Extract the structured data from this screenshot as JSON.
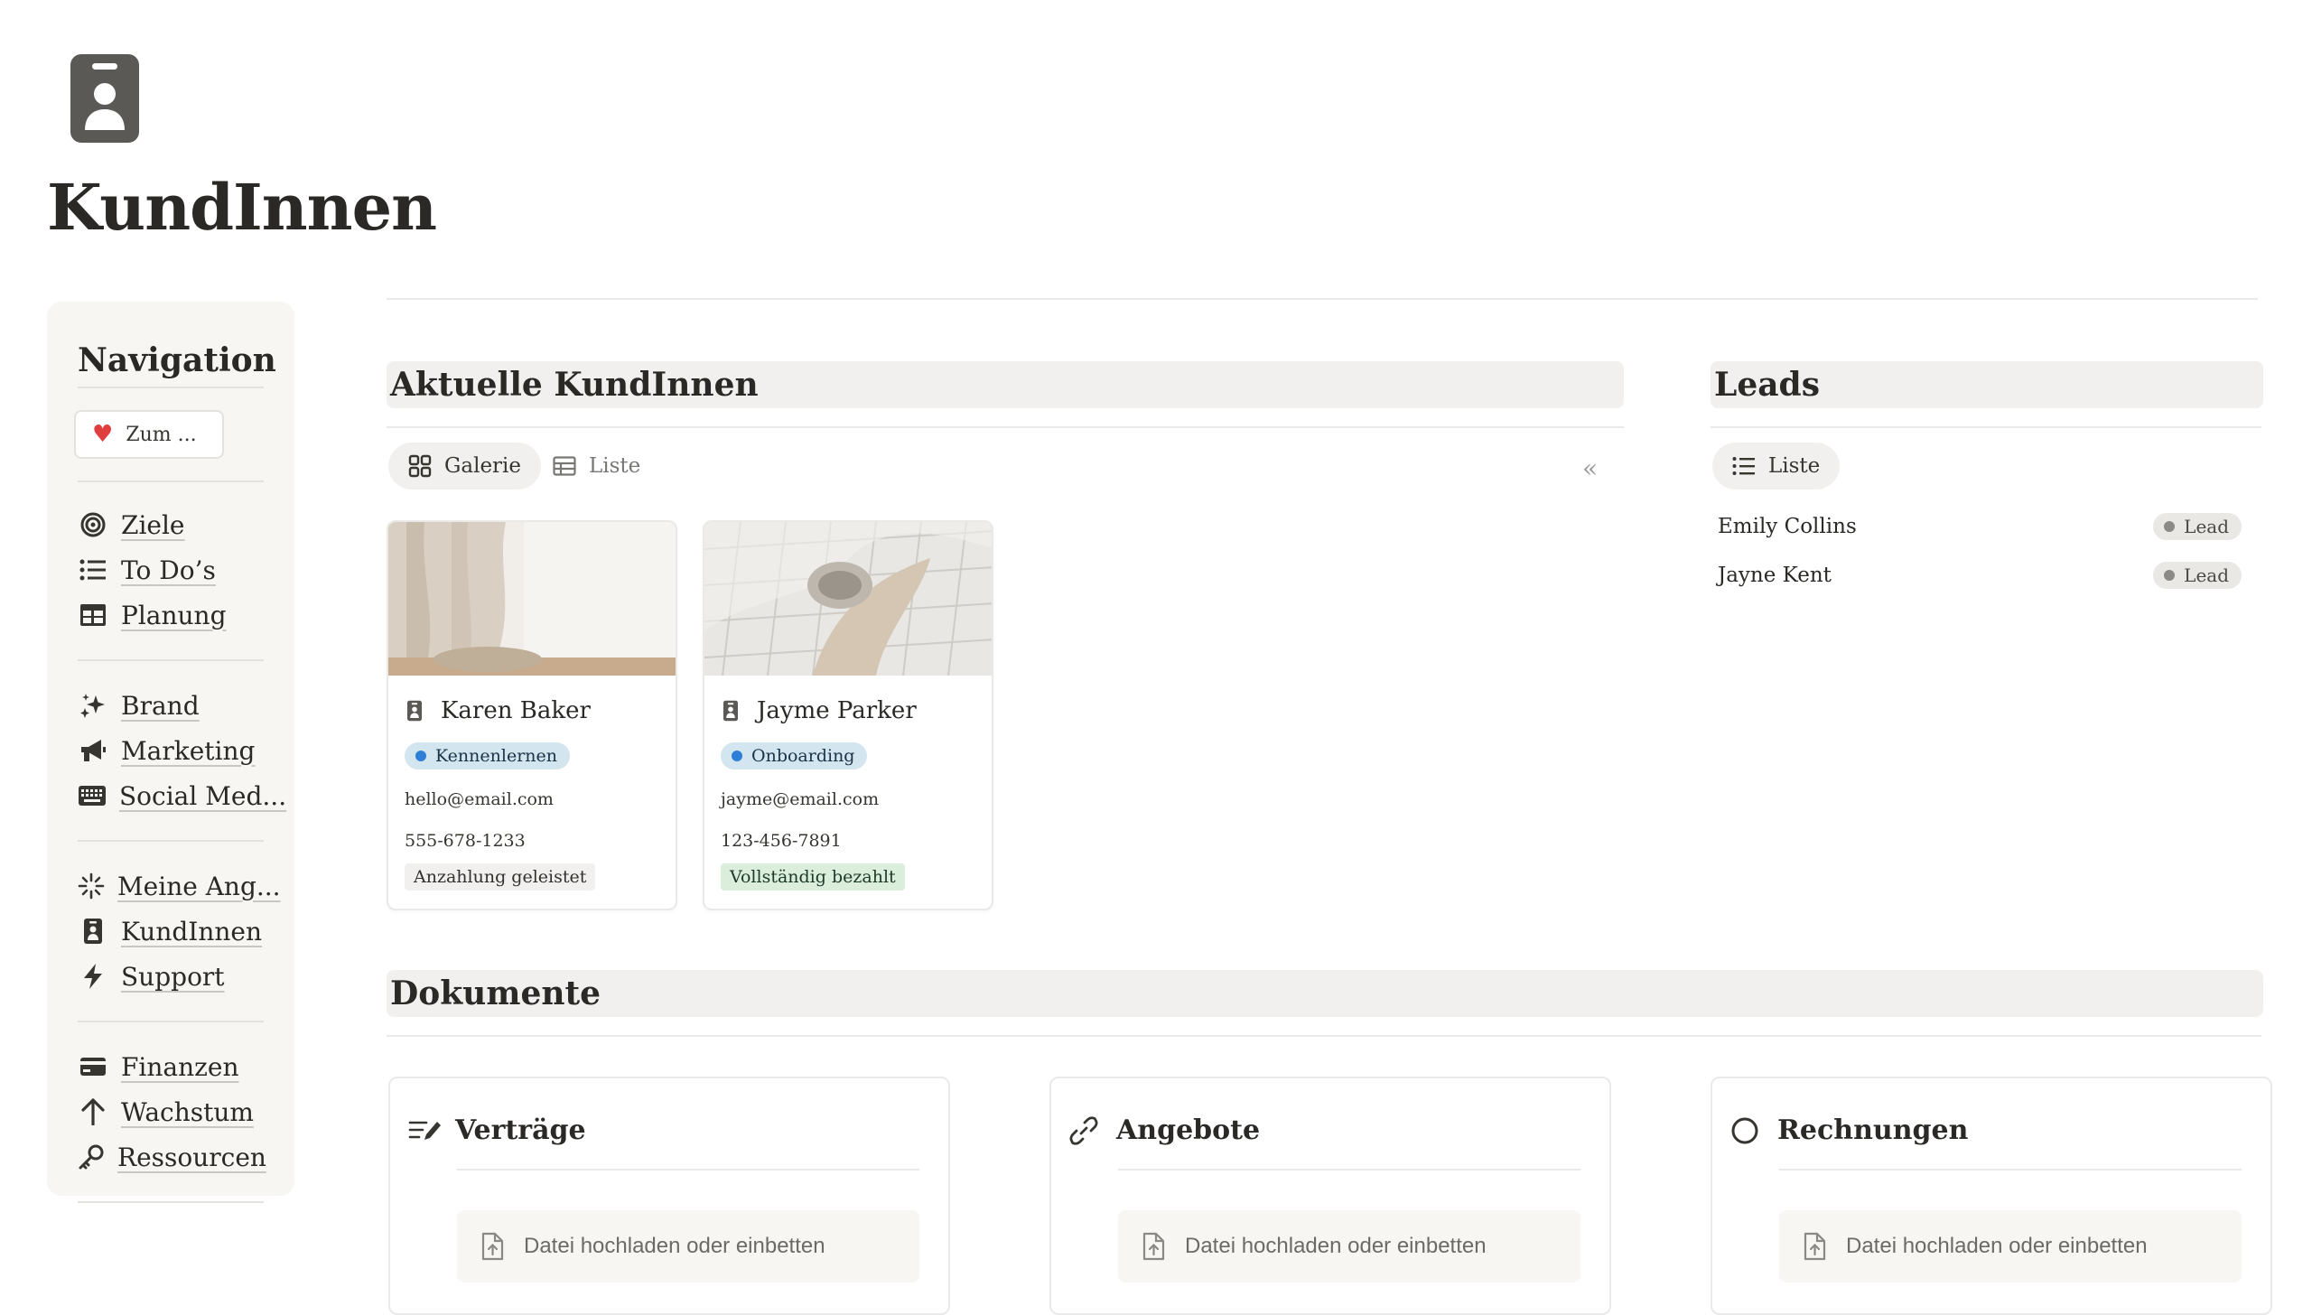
{
  "page": {
    "icon": "contact-card-icon",
    "title": "KundInnen"
  },
  "nav": {
    "title": "Navigation",
    "favorite": {
      "icon": "heart-icon",
      "label": "Zum ..."
    },
    "groups": [
      [
        {
          "icon": "target-icon",
          "label": "Ziele"
        },
        {
          "icon": "list-icon",
          "label": "To Do’s"
        },
        {
          "icon": "table-icon",
          "label": "Planung"
        }
      ],
      [
        {
          "icon": "sparkle-icon",
          "label": "Brand"
        },
        {
          "icon": "megaphone-icon",
          "label": "Marketing"
        },
        {
          "icon": "keyboard-icon",
          "label": "Social Med..."
        }
      ],
      [
        {
          "icon": "burst-icon",
          "label": "Meine Ang..."
        },
        {
          "icon": "contact-card-icon",
          "label": "KundInnen"
        },
        {
          "icon": "lightning-icon",
          "label": "Support"
        }
      ],
      [
        {
          "icon": "credit-card-icon",
          "label": "Finanzen"
        },
        {
          "icon": "arrow-up-icon",
          "label": "Wachstum"
        },
        {
          "icon": "key-icon",
          "label": "Ressourcen"
        }
      ]
    ]
  },
  "current": {
    "title": "Aktuelle KundInnen",
    "tabs": [
      {
        "label": "Galerie",
        "icon": "gallery-icon",
        "active": true
      },
      {
        "label": "Liste",
        "icon": "table-icon",
        "active": false
      }
    ],
    "collapse_icon": "double-chevron-left-icon",
    "cards": [
      {
        "name": "Karen Baker",
        "status": "Kennenlernen",
        "email": "hello@email.com",
        "phone": "555-678-1233",
        "payment": "Anzahlung geleistet",
        "payment_color": "#f1f0ee"
      },
      {
        "name": "Jayme Parker",
        "status": "Onboarding",
        "email": "jayme@email.com",
        "phone": "123-456-7891",
        "payment": "Vollständig bezahlt",
        "payment_color": "#dbeddb"
      }
    ]
  },
  "leads": {
    "title": "Leads",
    "tab": {
      "label": "Liste",
      "icon": "list-icon"
    },
    "rows": [
      {
        "name": "Emily Collins",
        "status": "Lead"
      },
      {
        "name": "Jayne Kent",
        "status": "Lead"
      }
    ]
  },
  "documents": {
    "title": "Dokumente",
    "cards": [
      {
        "icon": "edit-lines-icon",
        "title": "Verträge",
        "upload": "Datei hochladen oder einbetten"
      },
      {
        "icon": "link-icon",
        "title": "Angebote",
        "upload": "Datei hochladen oder einbetten"
      },
      {
        "icon": "circle-icon",
        "title": "Rechnungen",
        "upload": "Datei hochladen oder einbetten"
      }
    ]
  },
  "colors": {
    "status_blue": "#d3e5ef",
    "status_blue_dot": "#2f7fd8",
    "section_bg": "#f1f0ee",
    "sidebar_bg": "#f7f6f3"
  }
}
